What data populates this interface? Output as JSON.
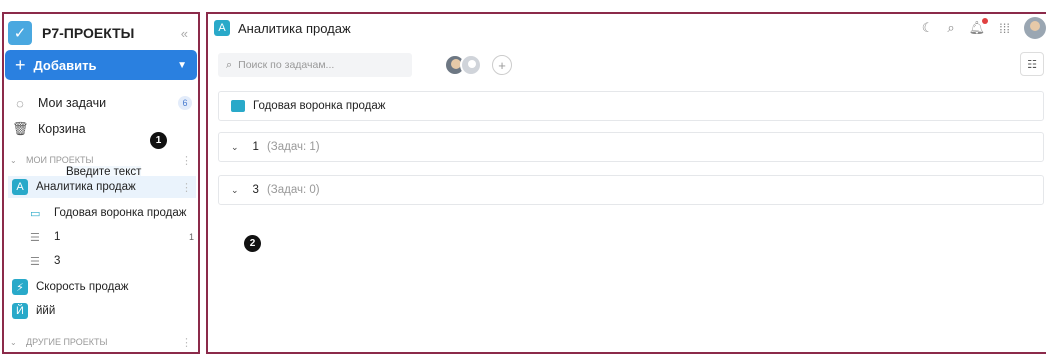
{
  "sidebar": {
    "logo_text": "Р7-ПРОЕКТЫ",
    "collapse_icon": "«",
    "add_label": "Добавить",
    "my_tasks": {
      "label": "Мои задачи",
      "count": "6"
    },
    "trash": {
      "label": "Корзина"
    },
    "my_projects_section": "МОИ ПРОЕКТЫ",
    "selected_project": {
      "badge": "А",
      "label": "Аналитика продаж",
      "edit_placeholder": "Введите текст"
    },
    "folder": {
      "label": "Годовая воронка продаж"
    },
    "lists": [
      {
        "label": "1",
        "count": "1"
      },
      {
        "label": "3",
        "count": ""
      }
    ],
    "projects": [
      {
        "badge": "⚡",
        "label": "Скорость продаж"
      },
      {
        "badge": "Й",
        "label": "ййй"
      }
    ],
    "other_projects_section": "ДРУГИЕ ПРОЕКТЫ"
  },
  "header": {
    "project_badge": "А",
    "title": "Аналитика продаж"
  },
  "toolbar": {
    "search_placeholder": "Поиск по задачам..."
  },
  "main": {
    "folder_card": {
      "label": "Годовая воронка продаж"
    },
    "groups": [
      {
        "name": "1",
        "count": "(Задач: 1)"
      },
      {
        "name": "3",
        "count": "(Задач: 0)"
      }
    ]
  },
  "markers": [
    "1",
    "2"
  ],
  "colors": {
    "accent": "#2a80e0",
    "project_teal": "#29a9c9",
    "frame": "#8b2a4a",
    "notification": "#e04040"
  }
}
